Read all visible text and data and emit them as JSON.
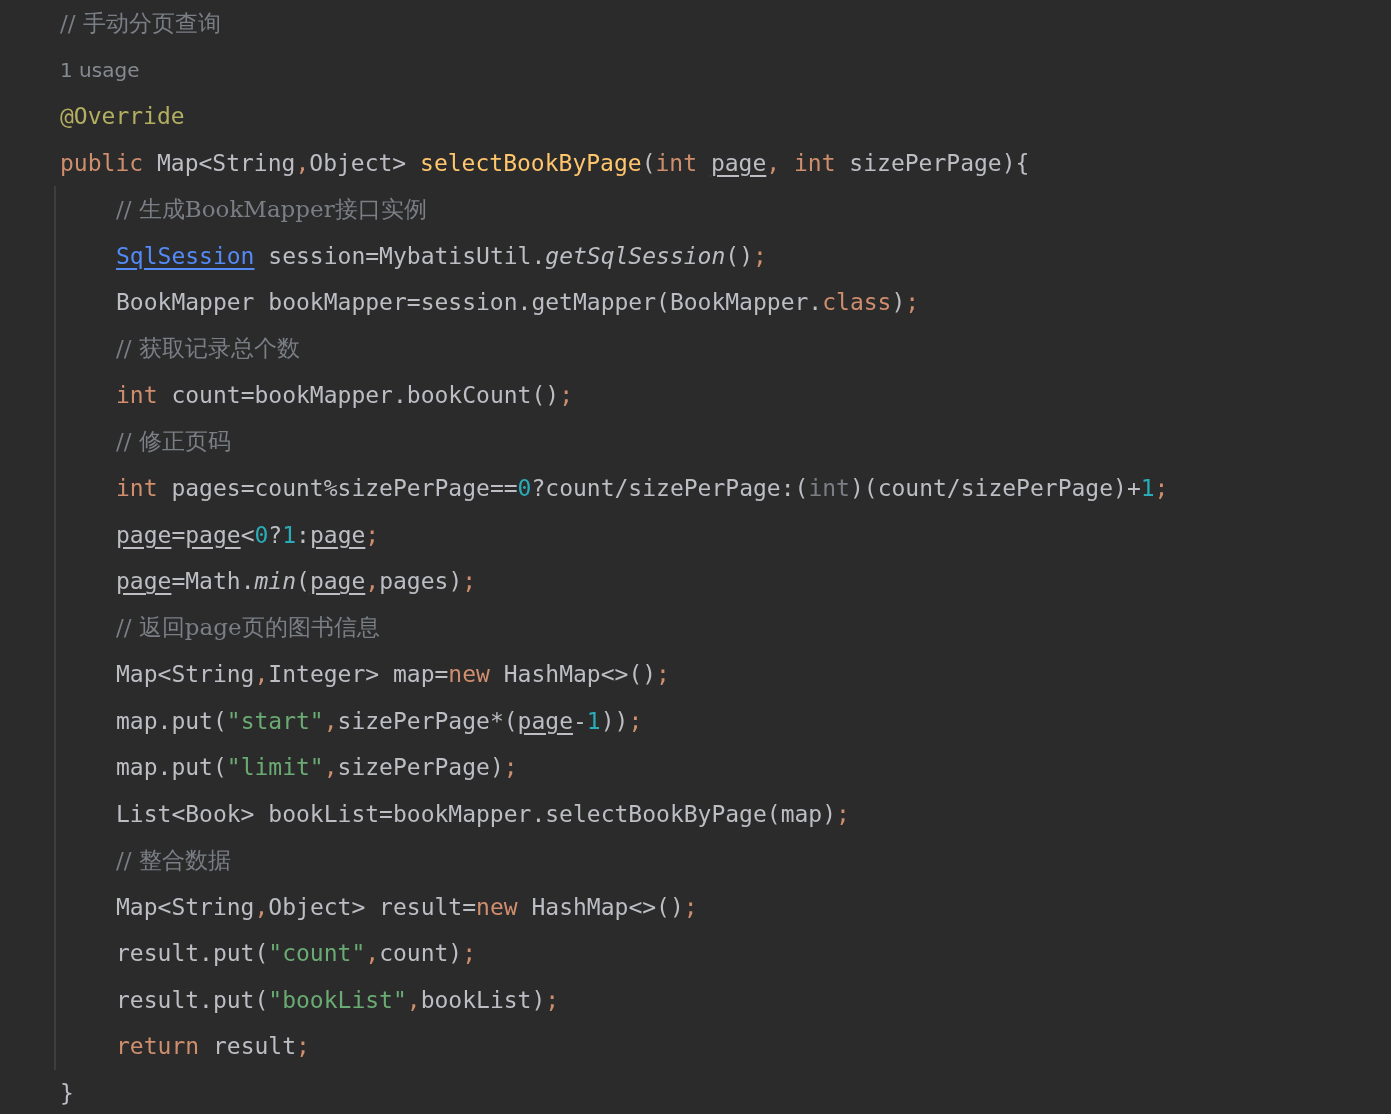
{
  "editor": {
    "header": [
      {
        "kind": "comment",
        "tokens": [
          {
            "kind": "comment",
            "text": "// 手动分页查询"
          }
        ]
      },
      {
        "kind": "usage",
        "tokens": [
          {
            "kind": "usage",
            "text": "1 usage"
          }
        ]
      },
      {
        "kind": "code",
        "tokens": [
          {
            "kind": "annotation",
            "text": "@Override"
          }
        ]
      },
      {
        "kind": "code",
        "tokens": [
          {
            "kind": "keyword",
            "text": "public"
          },
          {
            "kind": "plain",
            "text": " Map<String"
          },
          {
            "kind": "punct",
            "text": ","
          },
          {
            "kind": "plain",
            "text": "Object> "
          },
          {
            "kind": "method-decl",
            "text": "selectBookByPage"
          },
          {
            "kind": "plain",
            "text": "("
          },
          {
            "kind": "keyword",
            "text": "int "
          },
          {
            "kind": "param-ref",
            "text": "page"
          },
          {
            "kind": "punct",
            "text": ", "
          },
          {
            "kind": "keyword",
            "text": "int"
          },
          {
            "kind": "plain",
            "text": " sizePerPage){"
          }
        ]
      }
    ],
    "children": [
      {
        "kind": "comment",
        "tokens": [
          {
            "kind": "comment",
            "text": "// 生成BookMapper接口实例"
          }
        ]
      },
      {
        "kind": "code",
        "tokens": [
          {
            "kind": "class-link",
            "text": "SqlSession"
          },
          {
            "kind": "plain",
            "text": " session=MybatisUtil."
          },
          {
            "kind": "italic",
            "text": "getSqlSession"
          },
          {
            "kind": "plain",
            "text": "()"
          },
          {
            "kind": "punct",
            "text": ";"
          }
        ]
      },
      {
        "kind": "code",
        "tokens": [
          {
            "kind": "plain",
            "text": "BookMapper bookMapper=session.getMapper(BookMapper."
          },
          {
            "kind": "keyword",
            "text": "class"
          },
          {
            "kind": "plain",
            "text": ")"
          },
          {
            "kind": "punct",
            "text": ";"
          }
        ]
      },
      {
        "kind": "comment",
        "tokens": [
          {
            "kind": "comment",
            "text": "// 获取记录总个数"
          }
        ]
      },
      {
        "kind": "code",
        "tokens": [
          {
            "kind": "keyword",
            "text": "int"
          },
          {
            "kind": "plain",
            "text": " count=bookMapper.bookCount()"
          },
          {
            "kind": "punct",
            "text": ";"
          }
        ]
      },
      {
        "kind": "comment",
        "tokens": [
          {
            "kind": "comment",
            "text": "// 修正页码"
          }
        ]
      },
      {
        "kind": "code",
        "tokens": [
          {
            "kind": "keyword",
            "text": "int"
          },
          {
            "kind": "plain",
            "text": " pages=count%sizePerPage=="
          },
          {
            "kind": "number",
            "text": "0"
          },
          {
            "kind": "plain",
            "text": "?count/sizePerPage:("
          },
          {
            "kind": "redundant",
            "text": "int"
          },
          {
            "kind": "plain",
            "text": ")(count/sizePerPage)+"
          },
          {
            "kind": "number",
            "text": "1"
          },
          {
            "kind": "punct",
            "text": ";"
          }
        ]
      },
      {
        "kind": "code",
        "tokens": [
          {
            "kind": "param-ref",
            "text": "page"
          },
          {
            "kind": "plain",
            "text": "="
          },
          {
            "kind": "param-ref",
            "text": "page"
          },
          {
            "kind": "plain",
            "text": "<"
          },
          {
            "kind": "number",
            "text": "0"
          },
          {
            "kind": "plain",
            "text": "?"
          },
          {
            "kind": "number",
            "text": "1"
          },
          {
            "kind": "plain",
            "text": ":"
          },
          {
            "kind": "param-ref",
            "text": "page"
          },
          {
            "kind": "punct",
            "text": ";"
          }
        ]
      },
      {
        "kind": "code",
        "tokens": [
          {
            "kind": "param-ref",
            "text": "page"
          },
          {
            "kind": "plain",
            "text": "=Math."
          },
          {
            "kind": "italic",
            "text": "min"
          },
          {
            "kind": "plain",
            "text": "("
          },
          {
            "kind": "param-ref",
            "text": "page"
          },
          {
            "kind": "punct",
            "text": ","
          },
          {
            "kind": "plain",
            "text": "pages)"
          },
          {
            "kind": "punct",
            "text": ";"
          }
        ]
      },
      {
        "kind": "comment",
        "tokens": [
          {
            "kind": "comment",
            "text": "// 返回page页的图书信息"
          }
        ]
      },
      {
        "kind": "code",
        "tokens": [
          {
            "kind": "plain",
            "text": "Map<String"
          },
          {
            "kind": "punct",
            "text": ","
          },
          {
            "kind": "plain",
            "text": "Integer> map="
          },
          {
            "kind": "keyword",
            "text": "new"
          },
          {
            "kind": "plain",
            "text": " HashMap<>()"
          },
          {
            "kind": "punct",
            "text": ";"
          }
        ]
      },
      {
        "kind": "code",
        "tokens": [
          {
            "kind": "plain",
            "text": "map.put("
          },
          {
            "kind": "string",
            "text": "\"start\""
          },
          {
            "kind": "punct",
            "text": ","
          },
          {
            "kind": "plain",
            "text": "sizePerPage*("
          },
          {
            "kind": "param-ref",
            "text": "page"
          },
          {
            "kind": "plain",
            "text": "-"
          },
          {
            "kind": "number",
            "text": "1"
          },
          {
            "kind": "plain",
            "text": "))"
          },
          {
            "kind": "punct",
            "text": ";"
          }
        ]
      },
      {
        "kind": "code",
        "tokens": [
          {
            "kind": "plain",
            "text": "map.put("
          },
          {
            "kind": "string",
            "text": "\"limit\""
          },
          {
            "kind": "punct",
            "text": ","
          },
          {
            "kind": "plain",
            "text": "sizePerPage)"
          },
          {
            "kind": "punct",
            "text": ";"
          }
        ]
      },
      {
        "kind": "code",
        "tokens": [
          {
            "kind": "plain",
            "text": "List<Book> bookList=bookMapper.selectBookByPage(map)"
          },
          {
            "kind": "punct",
            "text": ";"
          }
        ]
      },
      {
        "kind": "comment",
        "tokens": [
          {
            "kind": "comment",
            "text": "// 整合数据"
          }
        ]
      },
      {
        "kind": "code",
        "tokens": [
          {
            "kind": "plain",
            "text": "Map<String"
          },
          {
            "kind": "punct",
            "text": ","
          },
          {
            "kind": "plain",
            "text": "Object> result="
          },
          {
            "kind": "keyword",
            "text": "new"
          },
          {
            "kind": "plain",
            "text": " HashMap<>()"
          },
          {
            "kind": "punct",
            "text": ";"
          }
        ]
      },
      {
        "kind": "code",
        "tokens": [
          {
            "kind": "plain",
            "text": "result.put("
          },
          {
            "kind": "string",
            "text": "\"count\""
          },
          {
            "kind": "punct",
            "text": ","
          },
          {
            "kind": "plain",
            "text": "count)"
          },
          {
            "kind": "punct",
            "text": ";"
          }
        ]
      },
      {
        "kind": "code",
        "tokens": [
          {
            "kind": "plain",
            "text": "result.put("
          },
          {
            "kind": "string",
            "text": "\"bookList\""
          },
          {
            "kind": "punct",
            "text": ","
          },
          {
            "kind": "plain",
            "text": "bookList)"
          },
          {
            "kind": "punct",
            "text": ";"
          }
        ]
      },
      {
        "kind": "code",
        "tokens": [
          {
            "kind": "keyword",
            "text": "return"
          },
          {
            "kind": "plain",
            "text": " result"
          },
          {
            "kind": "punct",
            "text": ";"
          }
        ]
      }
    ],
    "footer": [
      {
        "kind": "code",
        "tokens": [
          {
            "kind": "plain",
            "text": "}"
          }
        ]
      }
    ]
  }
}
